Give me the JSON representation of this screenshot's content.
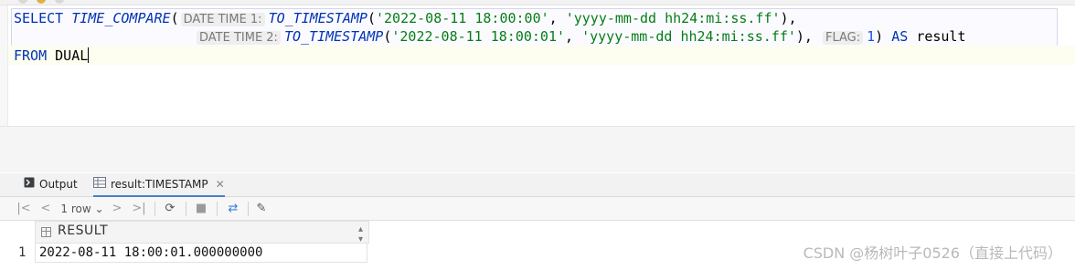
{
  "editor": {
    "line1": {
      "kw_select": "SELECT",
      "fn_compare": "TIME_COMPARE",
      "paren_open": "(",
      "hint1": "DATE TIME 1:",
      "fn_ts1": "TO_TIMESTAMP",
      "p1": "(",
      "str_date1": "'2022-08-11 18:00:00'",
      "comma1": ", ",
      "str_fmt1": "'yyyy-mm-dd hh24:mi:ss.ff'",
      "tail1": "),"
    },
    "line2": {
      "hint2": "DATE TIME 2:",
      "fn_ts2": "TO_TIMESTAMP",
      "p2": "(",
      "str_date2": "'2022-08-11 18:00:01'",
      "comma2": ", ",
      "str_fmt2": "'yyyy-mm-dd hh24:mi:ss.ff'",
      "tail2": "), ",
      "hint3": "FLAG:",
      "flag_val": "1",
      "close": ")",
      "kw_as": " AS ",
      "alias": "result"
    },
    "line3": {
      "kw_from": "FROM",
      "table": " DUAL"
    }
  },
  "panel": {
    "tabs": [
      {
        "label": "Output",
        "icon": "console-icon"
      },
      {
        "label": "result:TIMESTAMP",
        "icon": "table-icon",
        "close": "✕"
      }
    ],
    "toolbar": {
      "first": "|<",
      "prev": "<",
      "row_count": "1 row",
      "next": ">",
      "last": ">|"
    }
  },
  "result_grid": {
    "columns": [
      "RESULT"
    ],
    "rows": [
      {
        "num": "1",
        "values": [
          "2022-08-11 18:00:01.000000000"
        ]
      }
    ]
  },
  "watermark": "CSDN @杨树叶子0526（直接上代码）",
  "colors": {
    "keyword": "#0033b3",
    "string": "#067d17",
    "number": "#1750eb",
    "accent": "#4083c9"
  }
}
